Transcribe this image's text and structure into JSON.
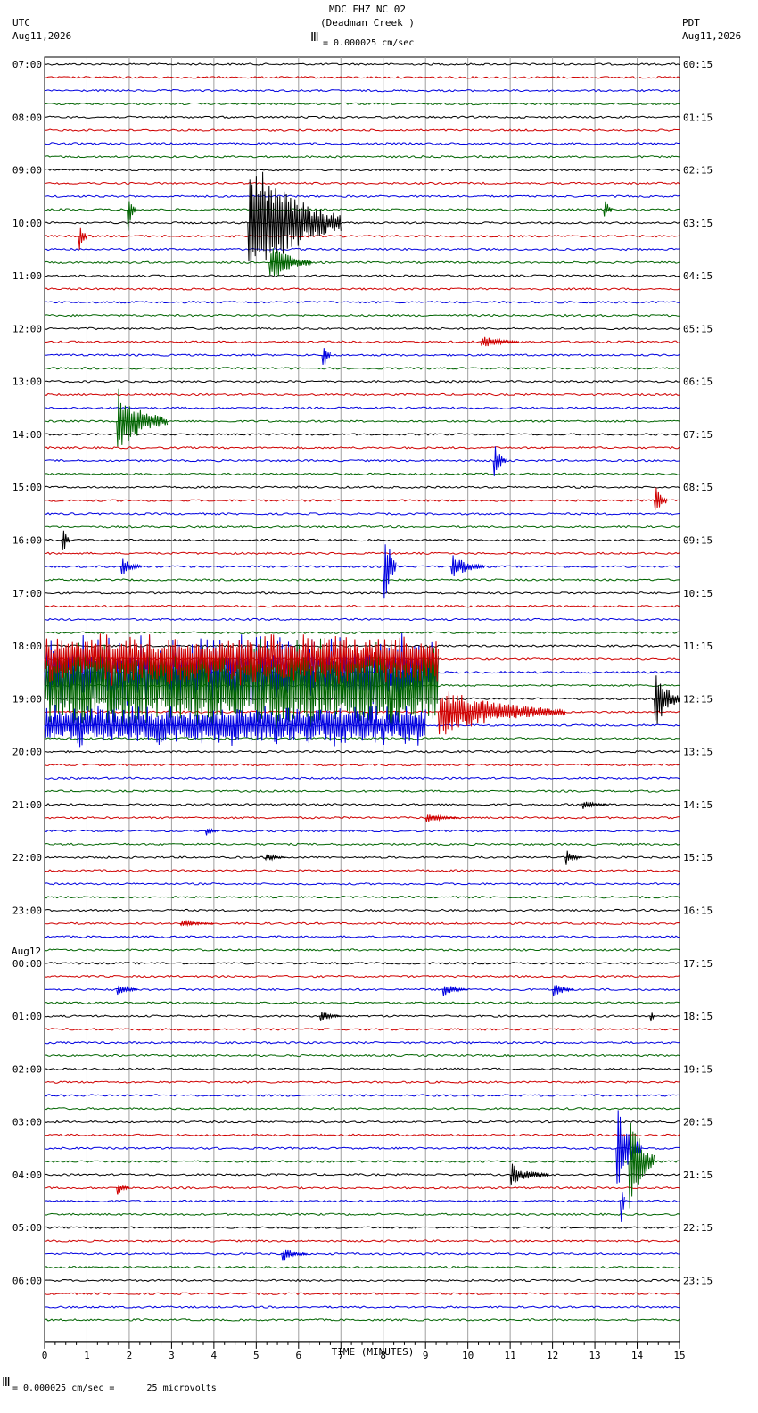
{
  "header": {
    "title": "MDC EHZ NC 02",
    "subtitle": "(Deadman Creek )",
    "scale": "= 0.000025 cm/sec",
    "left_tz": "UTC",
    "left_date": "Aug11,2026",
    "right_tz": "PDT",
    "right_date": "Aug11,2026"
  },
  "footer": {
    "scale_note": "= 0.000025 cm/sec =      25 microvolts"
  },
  "colors": {
    "trace_cycle": [
      "#000000",
      "#d00000",
      "#0000e0",
      "#006400"
    ],
    "grid": "#a0a0a0"
  },
  "chart_data": {
    "type": "line",
    "xlabel": "TIME (MINUTES)",
    "xlim": [
      0,
      15
    ],
    "x_ticks": [
      "0",
      "1",
      "2",
      "3",
      "4",
      "5",
      "6",
      "7",
      "8",
      "9",
      "10",
      "11",
      "12",
      "13",
      "14",
      "15"
    ],
    "traces_per_hour": 4,
    "trace_count": 96,
    "left_labels": [
      {
        "row": 0,
        "text": "07:00"
      },
      {
        "row": 4,
        "text": "08:00"
      },
      {
        "row": 8,
        "text": "09:00"
      },
      {
        "row": 12,
        "text": "10:00"
      },
      {
        "row": 16,
        "text": "11:00"
      },
      {
        "row": 20,
        "text": "12:00"
      },
      {
        "row": 24,
        "text": "13:00"
      },
      {
        "row": 28,
        "text": "14:00"
      },
      {
        "row": 32,
        "text": "15:00"
      },
      {
        "row": 36,
        "text": "16:00"
      },
      {
        "row": 40,
        "text": "17:00"
      },
      {
        "row": 44,
        "text": "18:00"
      },
      {
        "row": 48,
        "text": "19:00"
      },
      {
        "row": 52,
        "text": "20:00"
      },
      {
        "row": 56,
        "text": "21:00"
      },
      {
        "row": 60,
        "text": "22:00"
      },
      {
        "row": 64,
        "text": "23:00"
      },
      {
        "row": 68,
        "text": "00:00",
        "date": "Aug12"
      },
      {
        "row": 72,
        "text": "01:00"
      },
      {
        "row": 76,
        "text": "02:00"
      },
      {
        "row": 80,
        "text": "03:00"
      },
      {
        "row": 84,
        "text": "04:00"
      },
      {
        "row": 88,
        "text": "05:00"
      },
      {
        "row": 92,
        "text": "06:00"
      }
    ],
    "right_labels": [
      {
        "row": 0,
        "text": "00:15"
      },
      {
        "row": 4,
        "text": "01:15"
      },
      {
        "row": 8,
        "text": "02:15"
      },
      {
        "row": 12,
        "text": "03:15"
      },
      {
        "row": 16,
        "text": "04:15"
      },
      {
        "row": 20,
        "text": "05:15"
      },
      {
        "row": 24,
        "text": "06:15"
      },
      {
        "row": 28,
        "text": "07:15"
      },
      {
        "row": 32,
        "text": "08:15"
      },
      {
        "row": 36,
        "text": "09:15"
      },
      {
        "row": 40,
        "text": "10:15"
      },
      {
        "row": 44,
        "text": "11:15"
      },
      {
        "row": 48,
        "text": "12:15"
      },
      {
        "row": 52,
        "text": "13:15"
      },
      {
        "row": 56,
        "text": "14:15"
      },
      {
        "row": 60,
        "text": "15:15"
      },
      {
        "row": 64,
        "text": "16:15"
      },
      {
        "row": 68,
        "text": "17:15"
      },
      {
        "row": 72,
        "text": "18:15"
      },
      {
        "row": 76,
        "text": "19:15"
      },
      {
        "row": 80,
        "text": "20:15"
      },
      {
        "row": 84,
        "text": "21:15"
      },
      {
        "row": 88,
        "text": "22:15"
      },
      {
        "row": 92,
        "text": "23:15"
      }
    ],
    "events": [
      {
        "row": 12,
        "t": 4.8,
        "amp": 85,
        "dur": 2.2
      },
      {
        "row": 15,
        "t": 5.3,
        "amp": 25,
        "dur": 1.0
      },
      {
        "row": 13,
        "t": 0.8,
        "amp": 22,
        "dur": 0.2
      },
      {
        "row": 11,
        "t": 13.2,
        "amp": 18,
        "dur": 0.2
      },
      {
        "row": 11,
        "t": 1.95,
        "amp": 40,
        "dur": 0.2
      },
      {
        "row": 21,
        "t": 10.3,
        "amp": 8,
        "dur": 0.9
      },
      {
        "row": 22,
        "t": 6.55,
        "amp": 30,
        "dur": 0.2
      },
      {
        "row": 27,
        "t": 1.7,
        "amp": 40,
        "dur": 1.2
      },
      {
        "row": 30,
        "t": 10.6,
        "amp": 25,
        "dur": 0.3
      },
      {
        "row": 33,
        "t": 14.4,
        "amp": 25,
        "dur": 0.3
      },
      {
        "row": 36,
        "t": 0.4,
        "amp": 25,
        "dur": 0.2
      },
      {
        "row": 38,
        "t": 1.8,
        "amp": 12,
        "dur": 0.5
      },
      {
        "row": 38,
        "t": 9.6,
        "amp": 15,
        "dur": 0.8
      },
      {
        "row": 38,
        "t": 8.0,
        "amp": 60,
        "dur": 0.3
      },
      {
        "row": 46,
        "t": 0.0,
        "amp": 45,
        "dur": 9.3
      },
      {
        "row": 47,
        "t": 0.0,
        "amp": 55,
        "dur": 9.3
      },
      {
        "row": 45,
        "t": 0.0,
        "amp": 30,
        "dur": 9.3
      },
      {
        "row": 48,
        "t": 14.4,
        "amp": 40,
        "dur": 0.6
      },
      {
        "row": 50,
        "t": 0.0,
        "amp": 25,
        "dur": 9.0
      },
      {
        "row": 49,
        "t": 9.3,
        "amp": 30,
        "dur": 3.0
      },
      {
        "row": 56,
        "t": 12.7,
        "amp": 6,
        "dur": 0.6
      },
      {
        "row": 57,
        "t": 9.0,
        "amp": 6,
        "dur": 0.8
      },
      {
        "row": 58,
        "t": 3.8,
        "amp": 7,
        "dur": 0.3
      },
      {
        "row": 60,
        "t": 12.3,
        "amp": 10,
        "dur": 0.4
      },
      {
        "row": 60,
        "t": 5.2,
        "amp": 6,
        "dur": 0.5
      },
      {
        "row": 65,
        "t": 3.2,
        "amp": 5,
        "dur": 0.8
      },
      {
        "row": 70,
        "t": 1.7,
        "amp": 8,
        "dur": 0.5
      },
      {
        "row": 70,
        "t": 9.4,
        "amp": 8,
        "dur": 0.6
      },
      {
        "row": 70,
        "t": 12.0,
        "amp": 10,
        "dur": 0.5
      },
      {
        "row": 72,
        "t": 6.5,
        "amp": 7,
        "dur": 0.5
      },
      {
        "row": 72,
        "t": 14.3,
        "amp": 15,
        "dur": 0.1
      },
      {
        "row": 82,
        "t": 13.5,
        "amp": 55,
        "dur": 0.6
      },
      {
        "row": 83,
        "t": 13.8,
        "amp": 65,
        "dur": 0.6
      },
      {
        "row": 84,
        "t": 11.0,
        "amp": 14,
        "dur": 0.9
      },
      {
        "row": 85,
        "t": 1.7,
        "amp": 12,
        "dur": 0.3
      },
      {
        "row": 90,
        "t": 5.6,
        "amp": 10,
        "dur": 0.6
      },
      {
        "row": 86,
        "t": 13.6,
        "amp": 50,
        "dur": 0.1
      }
    ]
  }
}
